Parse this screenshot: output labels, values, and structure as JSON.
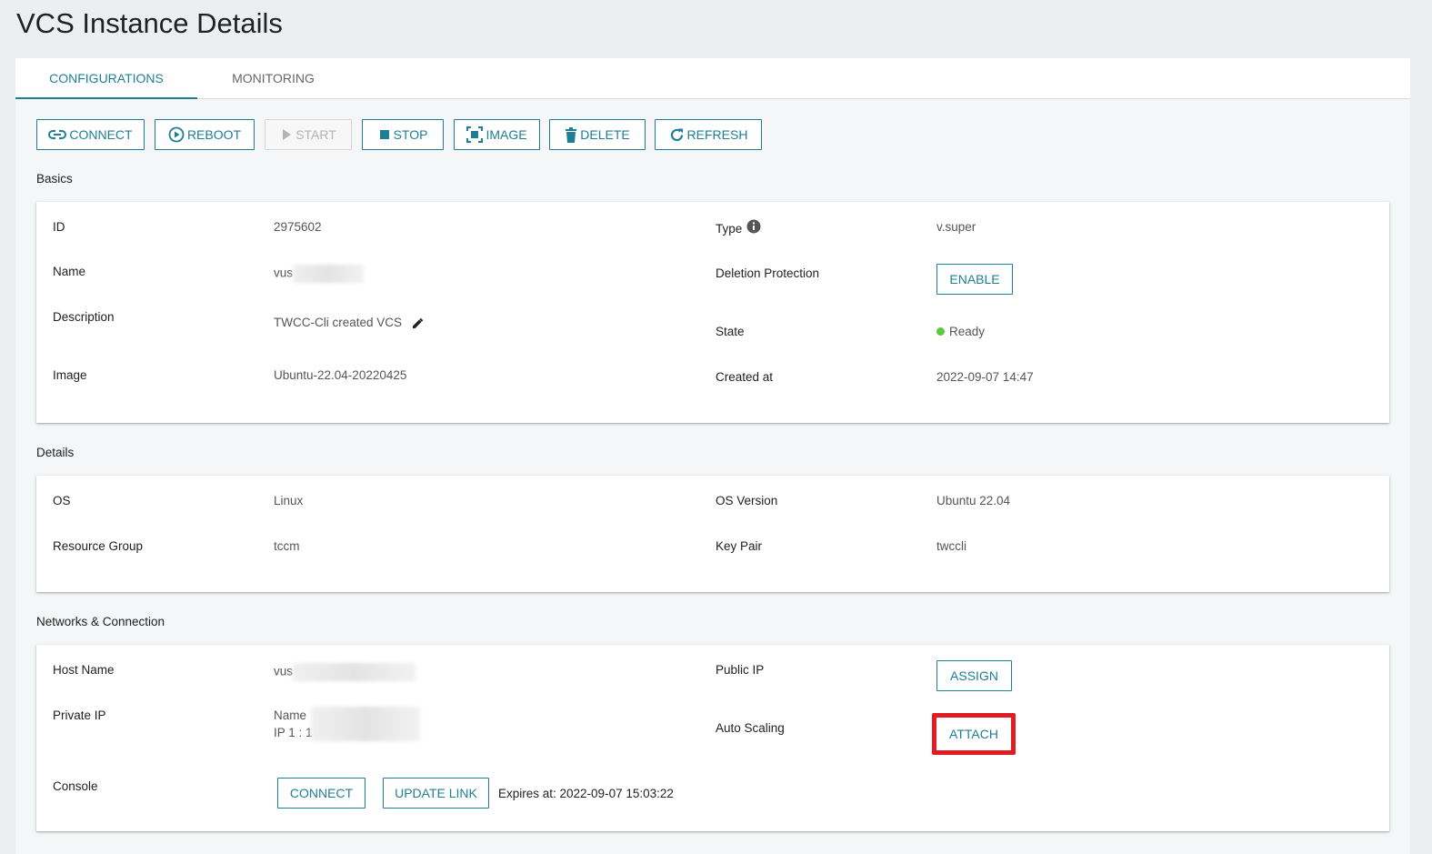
{
  "page": {
    "title": "VCS Instance Details"
  },
  "tabs": {
    "configurations": "CONFIGURATIONS",
    "monitoring": "MONITORING"
  },
  "toolbar": {
    "connect": "CONNECT",
    "reboot": "REBOOT",
    "start": "START",
    "stop": "STOP",
    "image": "IMAGE",
    "delete": "DELETE",
    "refresh": "REFRESH"
  },
  "basics": {
    "section": "Basics",
    "id_label": "ID",
    "id_value": "2975602",
    "name_label": "Name",
    "name_value": "vus",
    "description_label": "Description",
    "description_value": "TWCC-Cli created VCS",
    "image_label": "Image",
    "image_value": "Ubuntu-22.04-20220425",
    "type_label": "Type",
    "type_value": "v.super",
    "deletion_label": "Deletion Protection",
    "deletion_button": "ENABLE",
    "state_label": "State",
    "state_value": "Ready",
    "created_label": "Created at",
    "created_value": "2022-09-07 14:47"
  },
  "details": {
    "section": "Details",
    "os_label": "OS",
    "os_value": "Linux",
    "rg_label": "Resource Group",
    "rg_value": "tccm",
    "osv_label": "OS Version",
    "osv_value": "Ubuntu 22.04",
    "kp_label": "Key Pair",
    "kp_value": "twccli"
  },
  "network": {
    "section": "Networks & Connection",
    "host_label": "Host Name",
    "host_value": "vus",
    "private_label": "Private IP",
    "private_name": "Name",
    "private_ip": "IP 1 : 1",
    "console_label": "Console",
    "console_connect": "CONNECT",
    "console_update": "UPDATE LINK",
    "expires": "Expires at: 2022-09-07 15:03:22",
    "public_label": "Public IP",
    "public_button": "ASSIGN",
    "autoscaling_label": "Auto Scaling",
    "autoscaling_button": "ATTACH"
  },
  "colors": {
    "accent": "#1d7e96",
    "status_ready": "#5cc93a",
    "highlight": "#e31b23"
  }
}
